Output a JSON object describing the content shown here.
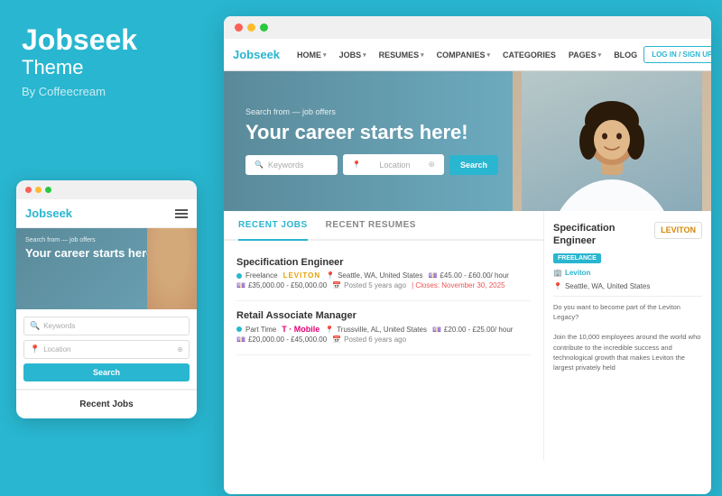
{
  "leftPanel": {
    "brandTitle": "Jobseek",
    "brandSubtitle": "Theme",
    "brandBy": "By Coffeecream"
  },
  "mobileMockup": {
    "navBrand": "Jobseek",
    "heroSub": "Search from — job offers",
    "heroTitle": "Your career starts here!",
    "keywordsPlaceholder": "Keywords",
    "locationPlaceholder": "Location",
    "searchBtn": "Search",
    "recentJobs": "Recent Jobs"
  },
  "browserWindow": {
    "navbar": {
      "brand": "Jobseek",
      "links": [
        {
          "label": "HOME",
          "hasChevron": true
        },
        {
          "label": "JOBS",
          "hasChevron": true
        },
        {
          "label": "RESUMES",
          "hasChevron": true
        },
        {
          "label": "COMPANIES",
          "hasChevron": true
        },
        {
          "label": "CATEGORIES",
          "hasChevron": false
        },
        {
          "label": "PAGES",
          "hasChevron": true
        },
        {
          "label": "BLOG",
          "hasChevron": false
        }
      ],
      "loginLabel": "LOG IN / SIGN UP"
    },
    "hero": {
      "sub": "Search from — job offers",
      "title": "Your career starts here!",
      "keywordsPlaceholder": "Keywords",
      "locationPlaceholder": "Location",
      "searchBtn": "Search"
    },
    "tabs": [
      {
        "label": "RECENT JOBS",
        "active": true
      },
      {
        "label": "RECENT RESUMES",
        "active": false
      }
    ],
    "jobs": [
      {
        "title": "Specification Engineer",
        "type": "Freelance",
        "company": "Leviton",
        "companyColor": "#d4870a",
        "location": "Seattle, WA, United States",
        "salaryRange": "£45.00 - £60.00/ hour",
        "salaryRange2": "£35,000.00 - £50,000.00",
        "posted": "Posted 5 years ago",
        "closes": "Closes: November 30, 2025",
        "logoType": "leviton"
      },
      {
        "title": "Retail Associate Manager",
        "type": "Part Time",
        "company": "T-Mobile",
        "companyColor": "#e20074",
        "location": "Trussville, AL, United States",
        "salaryRange": "£20.00 - £25.00/ hour",
        "salaryRange2": "£20,000.00 - £45,000.00",
        "posted": "Posted 6 years ago",
        "closes": "",
        "logoType": "tmobile"
      }
    ],
    "detail": {
      "jobTitle": "Specification Engineer",
      "badge": "FREELANCE",
      "company": "Leviton",
      "location": "Seattle, WA, United States",
      "description": "Do you want to become part of the Leviton Legacy?\n\nJoin the 10,000 employees around the world who contribute to the incredible success and technological growth that makes Leviton the largest privately held"
    }
  },
  "dots": {
    "colors": [
      "#ff5f57",
      "#febc2e",
      "#28c840"
    ]
  }
}
